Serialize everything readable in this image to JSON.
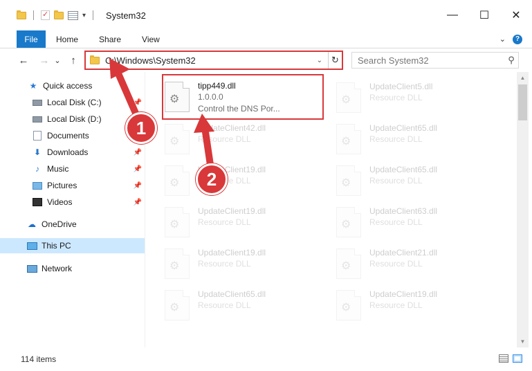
{
  "window": {
    "title": "System32",
    "minimize_glyph": "—",
    "maximize_glyph": "☐",
    "close_glyph": "✕"
  },
  "ribbon": {
    "tabs": [
      "File",
      "Home",
      "Share",
      "View"
    ],
    "expand_glyph": "⌄",
    "help_glyph": "?"
  },
  "nav": {
    "back_glyph": "←",
    "forward_glyph": "→",
    "recent_glyph": "⌄",
    "up_glyph": "↑",
    "address_path": "C:\\Windows\\System32",
    "address_dropdown_glyph": "⌄",
    "refresh_glyph": "↻",
    "search_placeholder": "Search System32",
    "search_glyph": "⚲"
  },
  "sidebar": {
    "items": [
      {
        "label": "Quick access",
        "icon": "star-icon",
        "pinned": false,
        "selected": false
      },
      {
        "label": "Local Disk (C:)",
        "icon": "drive-icon",
        "pinned": true,
        "selected": false
      },
      {
        "label": "Local Disk (D:)",
        "icon": "drive-icon",
        "pinned": false,
        "selected": false
      },
      {
        "label": "Documents",
        "icon": "documents-icon",
        "pinned": true,
        "selected": false
      },
      {
        "label": "Downloads",
        "icon": "downloads-icon",
        "pinned": true,
        "selected": false
      },
      {
        "label": "Music",
        "icon": "music-icon",
        "pinned": true,
        "selected": false
      },
      {
        "label": "Pictures",
        "icon": "pictures-icon",
        "pinned": true,
        "selected": false
      },
      {
        "label": "Videos",
        "icon": "videos-icon",
        "pinned": true,
        "selected": false
      },
      {
        "label": "OneDrive",
        "icon": "onedrive-icon",
        "pinned": false,
        "selected": false
      },
      {
        "label": "This PC",
        "icon": "this-pc-icon",
        "pinned": false,
        "selected": true
      },
      {
        "label": "Network",
        "icon": "network-icon",
        "pinned": false,
        "selected": false
      }
    ],
    "pin_glyph": "📌"
  },
  "files": {
    "highlighted": {
      "name": "tipp449.dll",
      "version": "1.0.0.0",
      "description": "Control the DNS Por..."
    },
    "left_column": [
      {
        "name": "UpdateClient42.dll",
        "type": "Resource DLL"
      },
      {
        "name": "UpdateClient19.dll",
        "type": "Resource DLL"
      },
      {
        "name": "UpdateClient19.dll",
        "type": "Resource DLL"
      },
      {
        "name": "UpdateClient19.dll",
        "type": "Resource DLL"
      },
      {
        "name": "UpdateClient65.dll",
        "type": "Resource DLL"
      }
    ],
    "right_column": [
      {
        "name": "UpdateClient5.dll",
        "type": "Resource DLL"
      },
      {
        "name": "UpdateClient65.dll",
        "type": "Resource DLL"
      },
      {
        "name": "UpdateClient65.dll",
        "type": "Resource DLL"
      },
      {
        "name": "UpdateClient63.dll",
        "type": "Resource DLL"
      },
      {
        "name": "UpdateClient21.dll",
        "type": "Resource DLL"
      },
      {
        "name": "UpdateClient19.dll",
        "type": "Resource DLL"
      }
    ],
    "file_icon_glyph": "⚙"
  },
  "statusbar": {
    "item_count": "114 items"
  },
  "scrollbar": {
    "up_glyph": "▲",
    "down_glyph": "▼"
  },
  "annotations": {
    "step1": "1",
    "step2": "2",
    "color": "#d8383a"
  }
}
